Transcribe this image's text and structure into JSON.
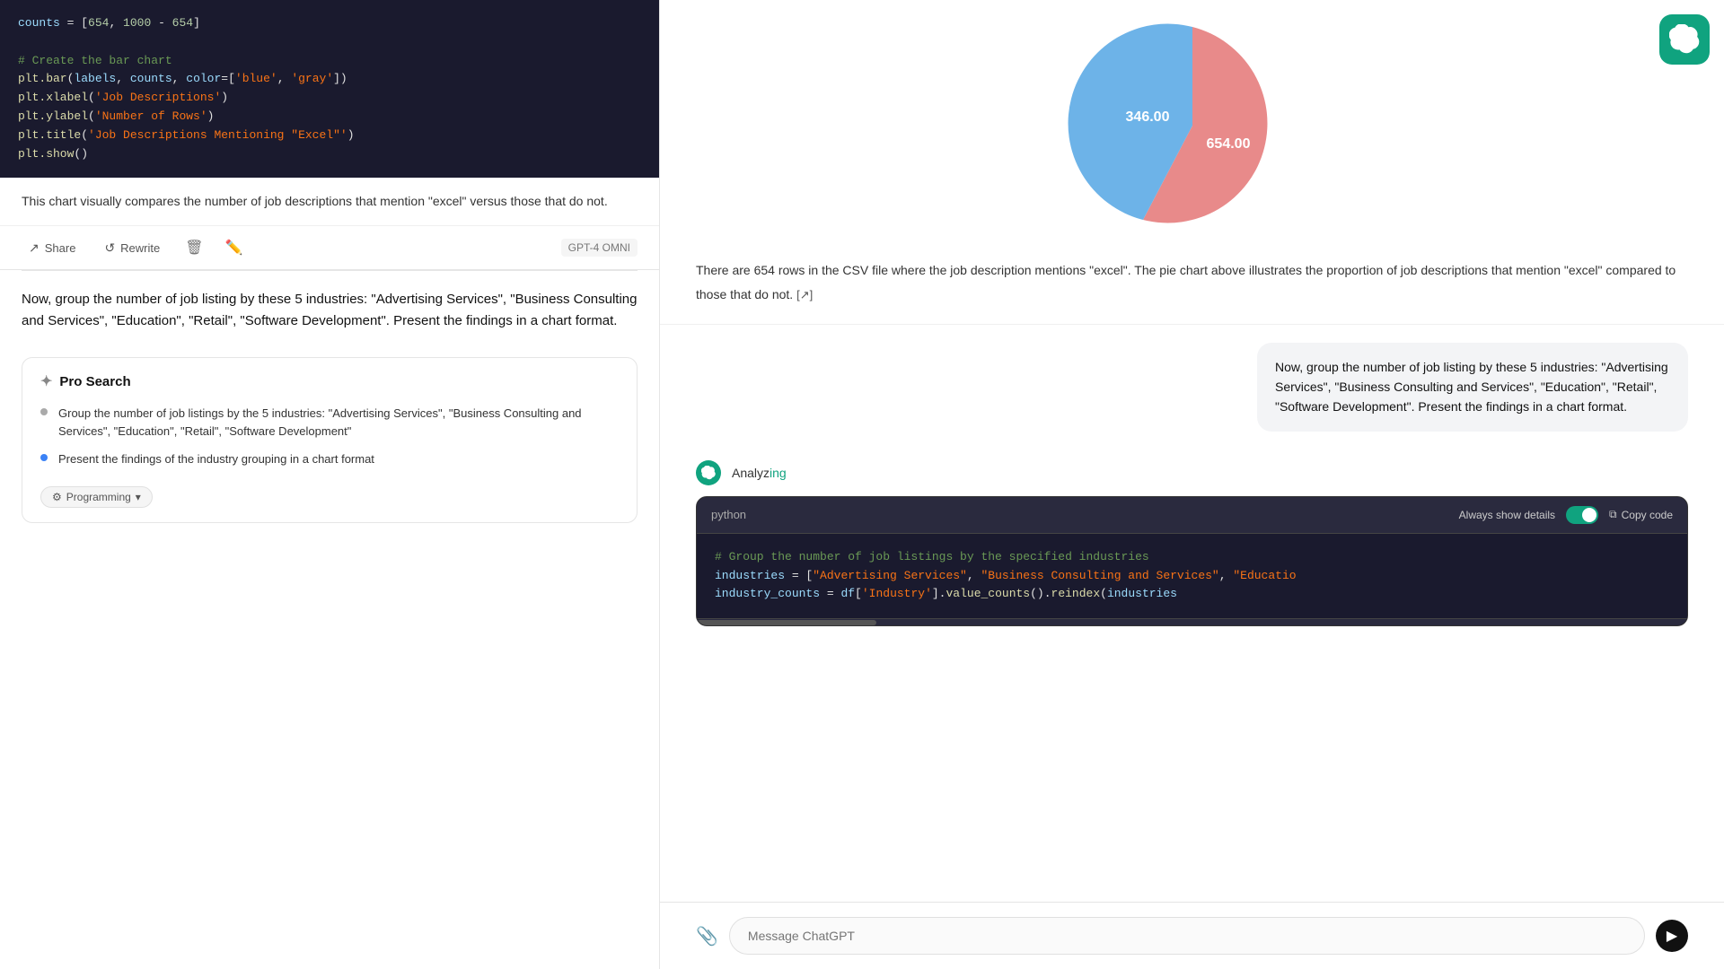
{
  "left": {
    "code_lines": [
      "counts = [654, 1000 - 654]",
      "",
      "# Create the bar chart",
      "plt.bar(labels, counts, color=['blue', 'gray'])",
      "plt.xlabel('Job Descriptions')",
      "plt.ylabel('Number of Rows')",
      "plt.title('Job Descriptions Mentioning \"Excel\"')",
      "plt.show()"
    ],
    "description": "This chart visually compares the number of job descriptions that mention \"excel\" versus those that do not.",
    "share_label": "Share",
    "rewrite_label": "Rewrite",
    "model_badge": "GPT-4 OMNI",
    "user_query": "Now, group the number of job listing by these 5 industries: \"Advertising Services\", \"Business Consulting and Services\", \"Education\", \"Retail\", \"Software Development\". Present the findings in a chart format.",
    "pro_search": {
      "title": "Pro Search",
      "items": [
        {
          "text": "Group the number of job listings by the 5 industries: \"Advertising Services\", \"Business Consulting and Services\", \"Education\", \"Retail\", \"Software Development\"",
          "active": false
        },
        {
          "text": "Present the findings of the industry grouping in a chart format",
          "active": true
        }
      ],
      "tag_label": "Programming",
      "tag_chevron": "▾"
    }
  },
  "right": {
    "pie_data": {
      "value1": 654,
      "value2": 346,
      "label1": "654.00",
      "label2": "346.00",
      "color1": "#e88a8a",
      "color2": "#6db3e8"
    },
    "response_text": "There are 654 rows in the CSV file where the job description mentions \"excel\". The pie chart above illustrates the proportion of job descriptions that mention \"excel\" compared to those that do not.",
    "expand_label": "[↗]",
    "user_bubble_text": "Now, group the number of job listing by these 5 industries: \"Advertising Services\", \"Business Consulting and Services\", \"Education\", \"Retail\", \"Software Development\". Present the findings in a chart format.",
    "analyzing_prefix": "Analyz",
    "analyzing_suffix": "ing",
    "python_block": {
      "language_label": "python",
      "always_show_label": "Always show details",
      "copy_code_label": "Copy code",
      "code_lines": [
        "# Group the number of job listings by the specified industries",
        "industries = [\"Advertising Services\", \"Business Consulting and Services\", \"Educatio",
        "industry_counts = df['Industry'].value_counts().reindex(industries"
      ]
    },
    "message_placeholder": "Message ChatGPT"
  }
}
